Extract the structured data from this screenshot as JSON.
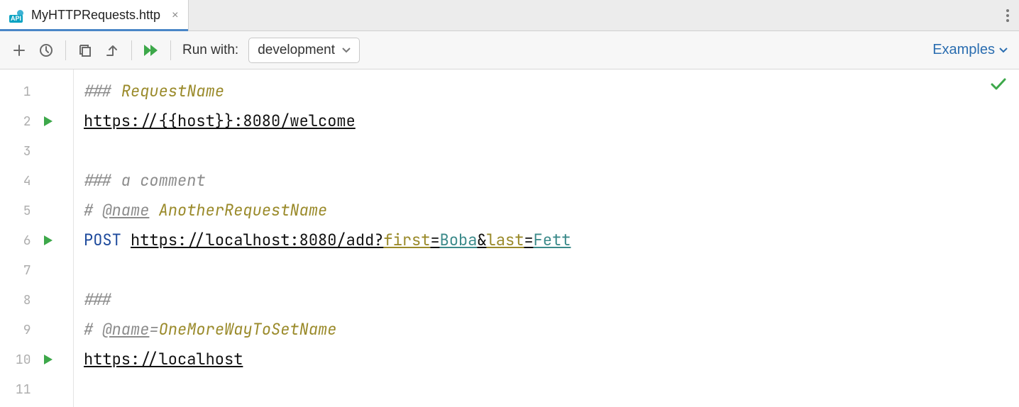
{
  "tab": {
    "label": "MyHTTPRequests.http",
    "iconBadge": "API"
  },
  "toolbar": {
    "runWithLabel": "Run with:",
    "envSelected": "development",
    "examplesLabel": "Examples"
  },
  "editor": {
    "lines": [
      {
        "num": "1",
        "run": false
      },
      {
        "num": "2",
        "run": true
      },
      {
        "num": "3",
        "run": false
      },
      {
        "num": "4",
        "run": false
      },
      {
        "num": "5",
        "run": false
      },
      {
        "num": "6",
        "run": true
      },
      {
        "num": "7",
        "run": false
      },
      {
        "num": "8",
        "run": false
      },
      {
        "num": "9",
        "run": false
      },
      {
        "num": "10",
        "run": true
      },
      {
        "num": "11",
        "run": false
      }
    ],
    "code": {
      "l1": {
        "hash": "### ",
        "name": "RequestName"
      },
      "l2": {
        "url": "https://{{host}}:8080/welcome"
      },
      "l4": {
        "text": "### a comment"
      },
      "l5": {
        "hash": "# ",
        "attr": "@name",
        "sp": " ",
        "name": "AnotherRequestName"
      },
      "l6": {
        "method": "POST",
        "url1": "https://localhost:8080/add?",
        "p1": "first",
        "eq1": "=",
        "v1": "Boba",
        "amp": "&",
        "p2": "last",
        "eq2": "=",
        "v2": "Fett"
      },
      "l8": {
        "text": "###"
      },
      "l9": {
        "hash": "# ",
        "attr": "@name",
        "eq": "=",
        "name": "OneMoreWayToSetName"
      },
      "l10": {
        "url": "https://localhost"
      }
    }
  },
  "colors": {
    "accent": "#2a6db0",
    "run": "#3da84a"
  }
}
